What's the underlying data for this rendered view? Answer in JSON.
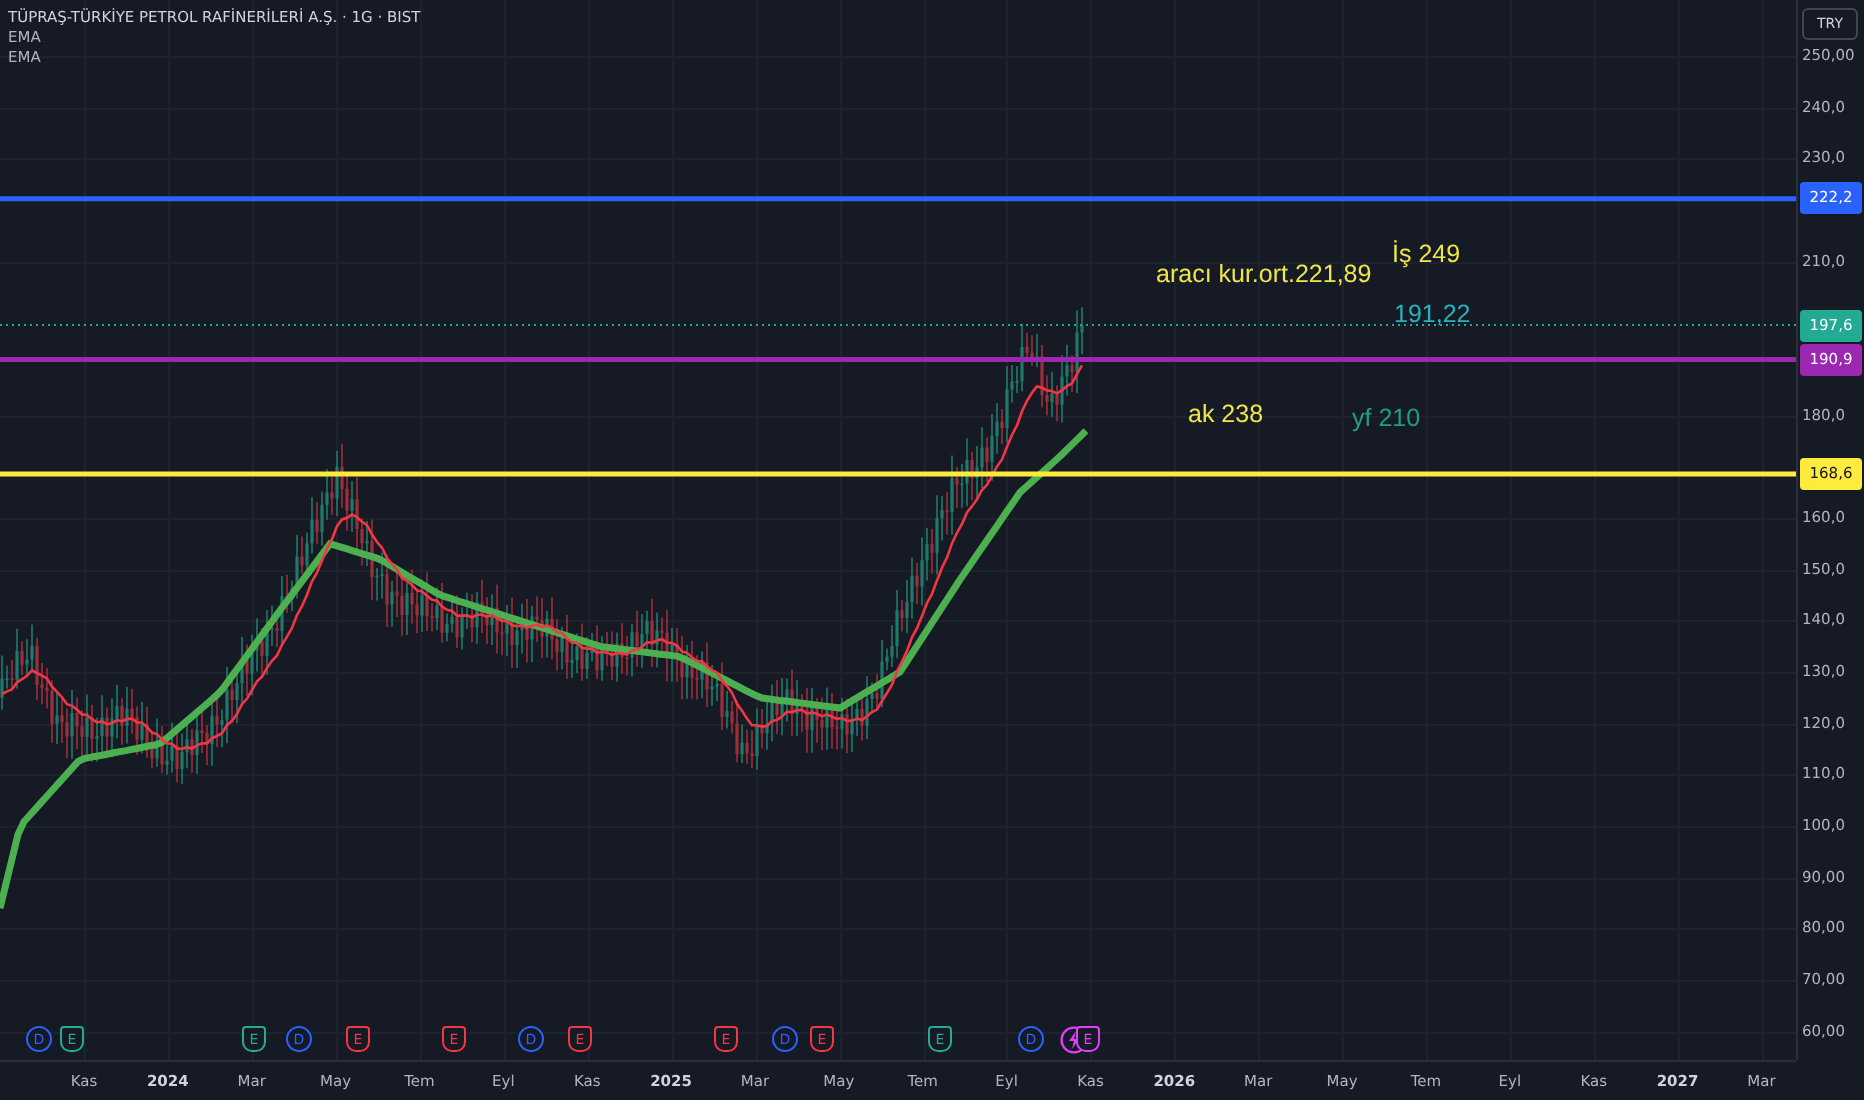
{
  "header": {
    "title": "TÜPRAŞ-TÜRKİYE PETROL RAFİNERİLERİ A.Ş. · 1G · BIST",
    "indicators": [
      "EMA",
      "EMA"
    ]
  },
  "currency_button": "TRY",
  "price_scale": {
    "ticks": [
      "250,00",
      "240,0",
      "230,0",
      "210,0",
      "180,0",
      "160,0",
      "150,0",
      "140,0",
      "130,0",
      "120,0",
      "110,0",
      "100,0",
      "90,00",
      "80,00",
      "70,00",
      "60,00"
    ]
  },
  "levels": [
    {
      "label": "222,2",
      "color": "#2962ff",
      "kind": "solid"
    },
    {
      "label": "197,6",
      "color": "#22ab94",
      "kind": "price"
    },
    {
      "label": "190,9",
      "color": "#9c27b0",
      "kind": "solid"
    },
    {
      "label": "168,6",
      "color": "#ffeb3b",
      "kind": "solid"
    }
  ],
  "annotations": [
    {
      "text": "aracı kur.ort.221,89",
      "color": "#f0e64a"
    },
    {
      "text": "İş 249",
      "color": "#f0e64a"
    },
    {
      "text": "191,22",
      "color": "#2ab0c0"
    },
    {
      "text": "ak 238",
      "color": "#f0e64a"
    },
    {
      "text": "yf 210",
      "color": "#1e9e86"
    }
  ],
  "events": [
    {
      "kind": "dividend",
      "letter": "D",
      "color": "#2962ff"
    },
    {
      "kind": "earnings",
      "letter": "E",
      "color": "#22ab94"
    },
    {
      "kind": "earnings",
      "letter": "E",
      "color": "#22ab94"
    },
    {
      "kind": "dividend",
      "letter": "D",
      "color": "#2962ff"
    },
    {
      "kind": "earnings",
      "letter": "E",
      "color": "#f23645"
    },
    {
      "kind": "earnings",
      "letter": "E",
      "color": "#f23645"
    },
    {
      "kind": "dividend",
      "letter": "D",
      "color": "#2962ff"
    },
    {
      "kind": "earnings",
      "letter": "E",
      "color": "#f23645"
    },
    {
      "kind": "earnings",
      "letter": "E",
      "color": "#f23645"
    },
    {
      "kind": "dividend",
      "letter": "D",
      "color": "#2962ff"
    },
    {
      "kind": "earnings",
      "letter": "E",
      "color": "#f23645"
    },
    {
      "kind": "earnings",
      "letter": "E",
      "color": "#22ab94"
    },
    {
      "kind": "dividend",
      "letter": "D",
      "color": "#2962ff"
    },
    {
      "kind": "split",
      "color": "#e040fb"
    },
    {
      "kind": "earnings",
      "letter": "E",
      "color": "#e040fb"
    }
  ],
  "time_axis": [
    {
      "label": "Kas",
      "kind": "month"
    },
    {
      "label": "2024",
      "kind": "year"
    },
    {
      "label": "Mar",
      "kind": "month"
    },
    {
      "label": "May",
      "kind": "month"
    },
    {
      "label": "Tem",
      "kind": "month"
    },
    {
      "label": "Eyl",
      "kind": "month"
    },
    {
      "label": "Kas",
      "kind": "month"
    },
    {
      "label": "2025",
      "kind": "year"
    },
    {
      "label": "Mar",
      "kind": "month"
    },
    {
      "label": "May",
      "kind": "month"
    },
    {
      "label": "Tem",
      "kind": "month"
    },
    {
      "label": "Eyl",
      "kind": "month"
    },
    {
      "label": "Kas",
      "kind": "month"
    },
    {
      "label": "2026",
      "kind": "year"
    },
    {
      "label": "Mar",
      "kind": "month"
    },
    {
      "label": "May",
      "kind": "month"
    },
    {
      "label": "Tem",
      "kind": "month"
    },
    {
      "label": "Eyl",
      "kind": "month"
    },
    {
      "label": "Kas",
      "kind": "month"
    },
    {
      "label": "2027",
      "kind": "year"
    },
    {
      "label": "Mar",
      "kind": "month"
    }
  ]
}
